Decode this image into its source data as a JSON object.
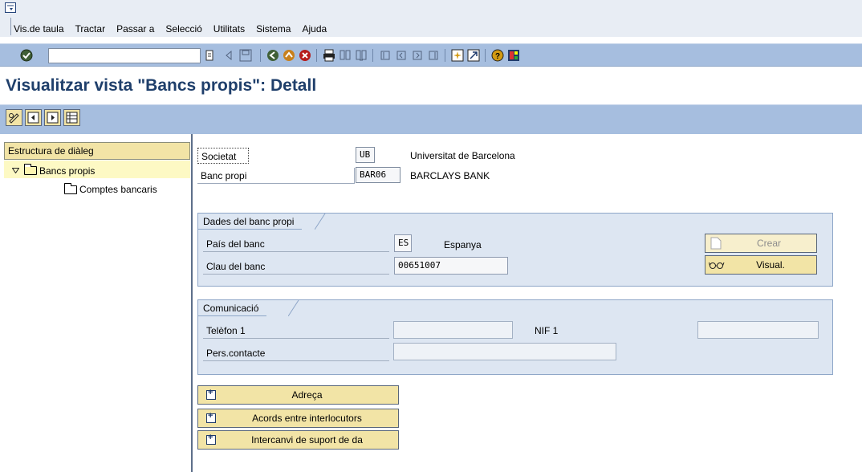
{
  "menu": {
    "items": [
      "Vis.de taula",
      "Tractar",
      "Passar a",
      "Selecció",
      "Utilitats",
      "Sistema",
      "Ajuda"
    ]
  },
  "toolbar": {
    "command_field_value": "",
    "icons": [
      "enter-icon",
      "back-icon",
      "save-icon",
      "back-nav-icon",
      "exit-icon",
      "cancel-icon",
      "print-icon",
      "find-icon",
      "find-next-icon",
      "first-page-icon",
      "previous-page-icon",
      "next-page-icon",
      "last-page-icon",
      "new-session-icon",
      "shortcut-icon",
      "help-icon",
      "layout-icon"
    ]
  },
  "page": {
    "title": "Visualitzar vista \"Bancs propis\": Detall"
  },
  "tree": {
    "header": "Estructura de diàleg",
    "root": "Bancs propis",
    "child": "Comptes bancaris"
  },
  "header_fields": {
    "societat_label": "Societat",
    "societat_value": "UB",
    "societat_text": "Universitat de Barcelona",
    "banc_label": "Banc propi",
    "banc_value": "BAR06",
    "banc_text": "BARCLAYS BANK"
  },
  "bank_group": {
    "title": "Dades del banc propi",
    "pais_label": "País del banc",
    "pais_value": "ES",
    "pais_text": "Espanya",
    "clau_label": "Clau del banc",
    "clau_value": "00651007",
    "crear_label": "Crear",
    "visual_label": "Visual."
  },
  "comm_group": {
    "title": "Comunicació",
    "tel_label": "Telèfon 1",
    "nif_label": "NIF 1",
    "contact_label": "Pers.contacte"
  },
  "expanders": [
    "Adreça",
    "Acords entre interlocutors",
    "Intercanvi de suport de da"
  ],
  "colors": {
    "title": "#1f3f6b",
    "toolbar": "#a6bedf",
    "button": "#f2e4a6",
    "group": "#dde6f2"
  }
}
